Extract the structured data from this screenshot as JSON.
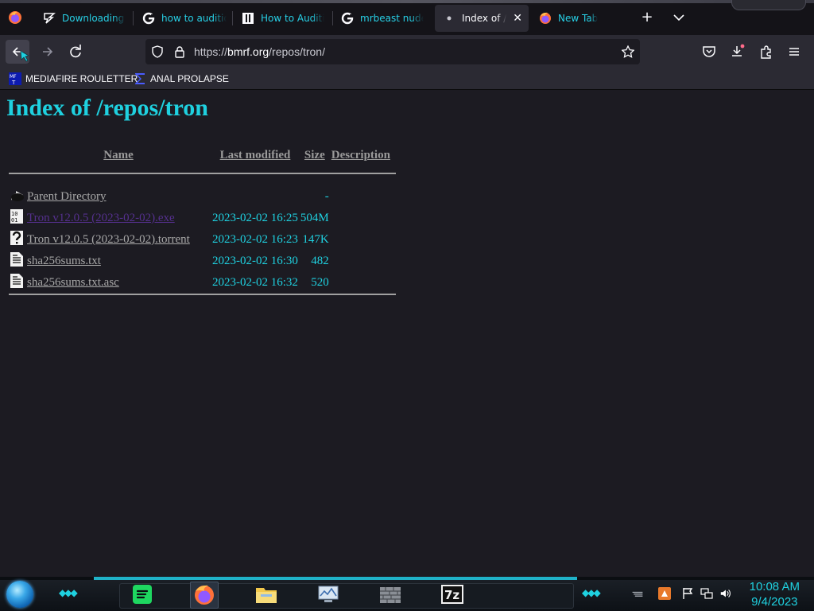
{
  "browser": {
    "tabs": [
      {
        "label": "Downloading C",
        "icon": "lightning-icon"
      },
      {
        "label": "how to audition",
        "icon": "google-icon"
      },
      {
        "label": "How to Auditio",
        "icon": "page-icon"
      },
      {
        "label": "mrbeast nudes",
        "icon": "google-icon"
      },
      {
        "label": "Index of /repos/tron",
        "icon": "dot-icon",
        "active": true
      },
      {
        "label": "New Tab",
        "icon": "firefox-icon"
      }
    ],
    "new_tab_label": "+",
    "url_prefix": "https://",
    "url_host": "bmrf.org",
    "url_path": "/repos/tron/",
    "bookmarks": [
      {
        "label": "MEDIAFIRE ROULETTER",
        "icon": "mediafire-icon"
      },
      {
        "label": "ANAL PROLAPSE",
        "icon": "sigma-icon"
      }
    ]
  },
  "page": {
    "title": "Index of /repos/tron",
    "columns": {
      "name": "Name",
      "modified": "Last modified",
      "size": "Size",
      "description": "Description"
    },
    "rows": [
      {
        "name": "Parent Directory",
        "modified": "",
        "size": "-",
        "icon": "back-folder-icon",
        "visited": false
      },
      {
        "name": "Tron v12.0.5 (2023-02-02).exe",
        "modified": "2023-02-02 16:25",
        "size": "504M",
        "icon": "binary-icon",
        "visited": true
      },
      {
        "name": "Tron v12.0.5 (2023-02-02).torrent",
        "modified": "2023-02-02 16:23",
        "size": "147K",
        "icon": "unknown-file-icon",
        "visited": false
      },
      {
        "name": "sha256sums.txt",
        "modified": "2023-02-02 16:30",
        "size": "482",
        "icon": "text-file-icon",
        "visited": false
      },
      {
        "name": "sha256sums.txt.asc",
        "modified": "2023-02-02 16:32",
        "size": "520",
        "icon": "text-file-icon",
        "visited": false
      }
    ]
  },
  "taskbar": {
    "apps": [
      "spotify-icon",
      "firefox-icon",
      "file-explorer-icon",
      "monitor-icon",
      "firewall-icon",
      "7zip-icon"
    ],
    "time": "10:08 AM",
    "date": "9/4/2023"
  },
  "colors": {
    "accent": "#1fd1e0",
    "link": "#a8a8a8",
    "visited": "#55308e",
    "background": "#1c1b22"
  }
}
